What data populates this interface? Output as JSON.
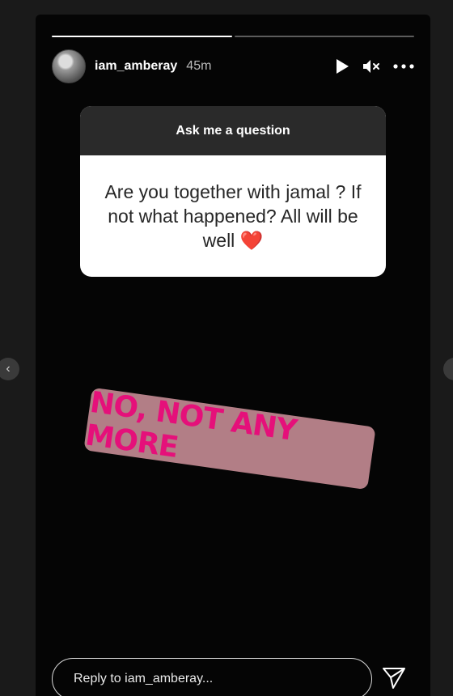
{
  "story": {
    "username": "iam_amberay",
    "time": "45m",
    "progress_segments": 2,
    "active_segment_fill": 1.0
  },
  "question_card": {
    "title": "Ask me a question",
    "question": "Are you together with jamal ? If not what happened? All will be well ❤️"
  },
  "sticker": {
    "text": "NO, NOT ANY MORE",
    "background_color": "#b27e86",
    "text_color": "#e5107a"
  },
  "reply": {
    "placeholder": "Reply to iam_amberay..."
  },
  "icons": [
    "play-icon",
    "mute-icon",
    "more-icon",
    "send-icon",
    "chevron-left-icon",
    "chevron-right-icon"
  ]
}
